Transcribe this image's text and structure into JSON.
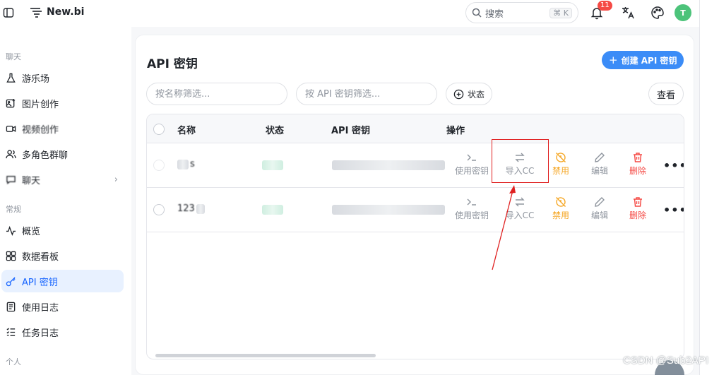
{
  "app": {
    "name": "New.bi"
  },
  "header": {
    "search_placeholder": "搜索",
    "search_shortcut": "⌘ K",
    "notification_count": "11",
    "avatar_letter": "T"
  },
  "sidebar": {
    "sections": [
      {
        "title": "聊天",
        "items": [
          {
            "label": "游乐场",
            "icon": "flask-icon"
          },
          {
            "label": "图片创作",
            "icon": "image-edit-icon"
          },
          {
            "label": "视频创作",
            "icon": "video-icon"
          },
          {
            "label": "多角色群聊",
            "icon": "users-icon"
          },
          {
            "label": "聊天",
            "icon": "chat-icon"
          }
        ]
      },
      {
        "title": "常规",
        "items": [
          {
            "label": "概览",
            "icon": "activity-icon"
          },
          {
            "label": "数据看板",
            "icon": "dashboard-icon"
          },
          {
            "label": "API 密钥",
            "icon": "key-icon",
            "active": true
          },
          {
            "label": "使用日志",
            "icon": "document-icon"
          },
          {
            "label": "任务日志",
            "icon": "list-icon"
          }
        ]
      },
      {
        "title": "个人",
        "items": []
      }
    ]
  },
  "main": {
    "title": "API 密钥",
    "create_button": "创建 API 密钥",
    "filters": {
      "name_placeholder": "按名称筛选...",
      "key_placeholder": "按 API 密钥筛选...",
      "status_label": "状态",
      "view_label": "查看"
    },
    "table": {
      "columns": [
        "名称",
        "状态",
        "API 密钥",
        "操作"
      ],
      "rows": [
        {
          "name": "s",
          "status": "",
          "key": ""
        },
        {
          "name": "123",
          "status": "",
          "key": ""
        }
      ],
      "actions": {
        "use": "使用密钥",
        "import": "导入CC",
        "disable": "禁用",
        "edit": "编辑",
        "delete": "删除",
        "more": "•••"
      }
    }
  },
  "watermark": "CSDN @Sub2API",
  "colors": {
    "accent": "#3b8cf7",
    "active_bg": "#e8f1ff",
    "warning": "#f5a623",
    "danger": "#f54a45",
    "annotation": "#e02020"
  }
}
